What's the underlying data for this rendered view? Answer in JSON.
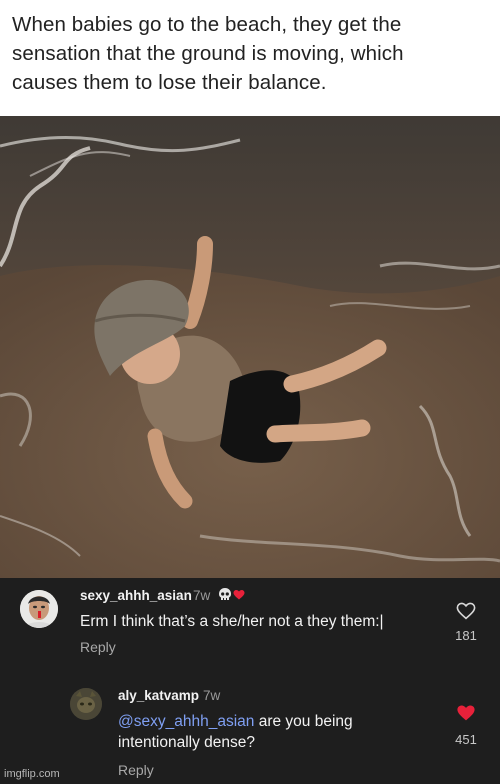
{
  "caption": {
    "lines": [
      "When babies go to the beach, they get the",
      "sensation that the ground is moving, which",
      "causes them to lose their balance."
    ]
  },
  "photo": {
    "subject": "baby-falling-in-beach-surf"
  },
  "comments": [
    {
      "username": "sexy_ahhh_asian",
      "time": "7w",
      "text": "Erm I think that’s a she/her not a they them:|",
      "reply_label": "Reply",
      "likes": "181",
      "liked": false,
      "badge_icons": [
        "skull-icon",
        "heart-icon"
      ]
    },
    {
      "username": "aly_katvamp",
      "time": "7w",
      "mention": "@sexy_ahhh_asian",
      "text": " are you being intentionally dense?",
      "reply_label": "Reply",
      "likes": "451",
      "liked": true
    }
  ],
  "watermark": "imgflip.com",
  "colors": {
    "comment_bg": "#1e1e1e",
    "mention": "#7f9ff2",
    "liked_heart": "#e8213a"
  }
}
